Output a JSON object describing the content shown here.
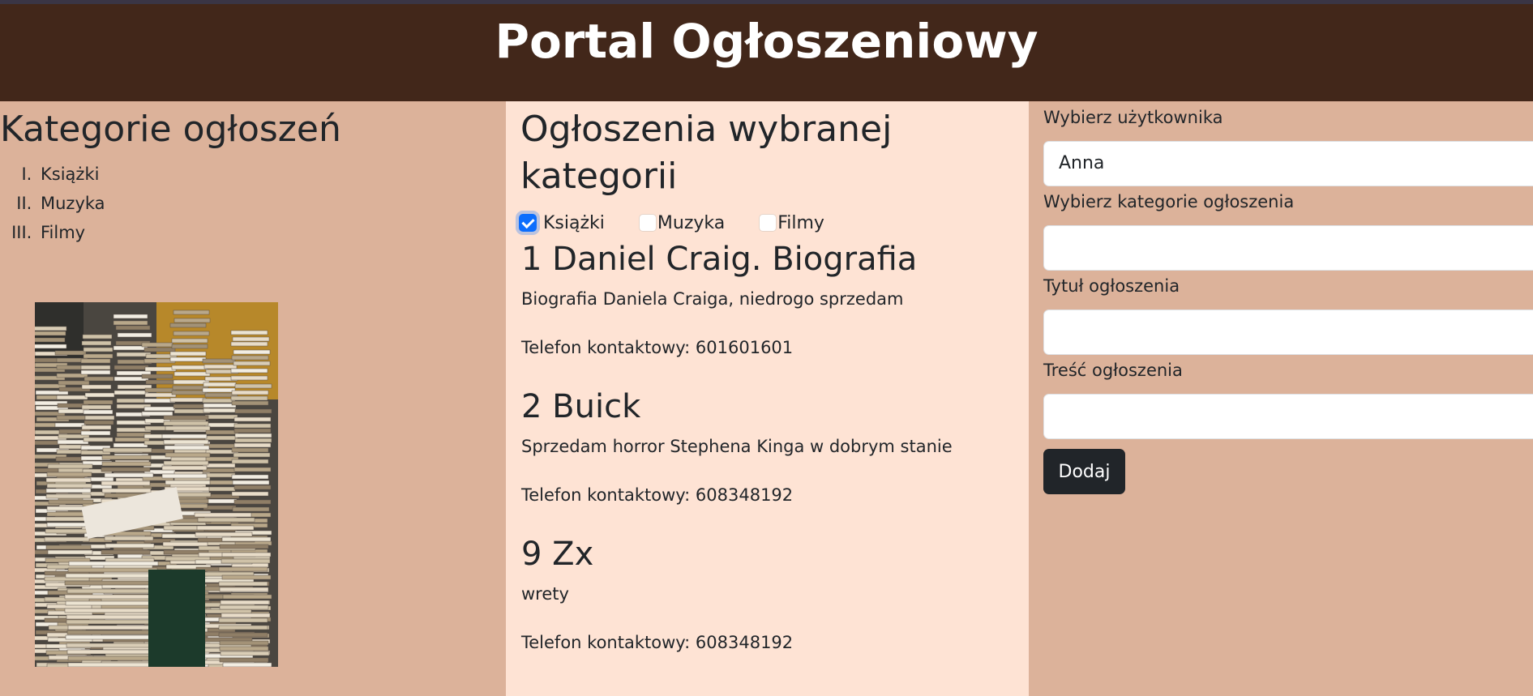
{
  "header": {
    "title": "Portal Ogłoszeniowy"
  },
  "categories_panel": {
    "heading": "Kategorie ogłoszeń",
    "items": [
      "Książki",
      "Muzyka",
      "Filmy"
    ]
  },
  "ads_panel": {
    "heading": "Ogłoszenia wybranej kategorii",
    "filters": [
      {
        "label": "Książki",
        "checked": true
      },
      {
        "label": "Muzyka",
        "checked": false
      },
      {
        "label": "Filmy",
        "checked": false
      }
    ],
    "ads": [
      {
        "title": "1 Daniel Craig. Biografia",
        "text": "Biografia Daniela Craiga, niedrogo sprzedam",
        "phone": "Telefon kontaktowy: 601601601"
      },
      {
        "title": "2 Buick",
        "text": "Sprzedam horror Stephena Kinga w dobrym stanie",
        "phone": "Telefon kontaktowy: 608348192"
      },
      {
        "title": "9 Zx",
        "text": "wrety",
        "phone": "Telefon kontaktowy: 608348192"
      }
    ]
  },
  "form": {
    "user_label": "Wybierz użytkownika",
    "user_value": "Anna",
    "category_label": "Wybierz kategorie ogłoszenia",
    "category_value": "",
    "title_label": "Tytuł ogłoszenia",
    "title_value": "",
    "content_label": "Treść ogłoszenia",
    "content_value": "",
    "submit_label": "Dodaj"
  },
  "colors": {
    "header_bg": "#42271a",
    "side_bg": "#dcb29a",
    "center_bg": "#fee3d4",
    "button_bg": "#212529",
    "checkbox_accent": "#0d6efd"
  }
}
